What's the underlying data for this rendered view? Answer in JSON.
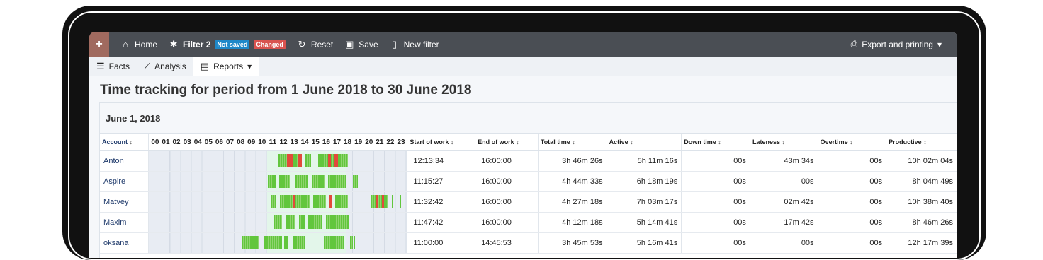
{
  "toolbar": {
    "plus": "+",
    "home": "Home",
    "filter": "Filter 2",
    "badge_not_saved": "Not saved",
    "badge_changed": "Changed",
    "reset": "Reset",
    "save": "Save",
    "new_filter": "New filter",
    "export": "Export and printing"
  },
  "tabs": [
    {
      "label": "Facts",
      "icon": "list-icon"
    },
    {
      "label": "Analysis",
      "icon": "line-chart-icon"
    },
    {
      "label": "Reports",
      "icon": "report-icon"
    }
  ],
  "page_title": "Time tracking for period from 1 June 2018 to 30 June 2018",
  "date_header": "June 1, 2018",
  "columns": {
    "account": "Account",
    "hours": [
      "00",
      "01",
      "02",
      "03",
      "04",
      "05",
      "06",
      "07",
      "08",
      "09",
      "10",
      "11",
      "12",
      "13",
      "14",
      "15",
      "16",
      "17",
      "18",
      "19",
      "20",
      "21",
      "22",
      "23"
    ],
    "start": "Start of work",
    "end": "End of work",
    "total": "Total time",
    "active": "Active",
    "down": "Down time",
    "lateness": "Lateness",
    "overtime": "Overtime",
    "productive": "Productive"
  },
  "rows": [
    {
      "account": "Anton",
      "start": "12:13:34",
      "end": "16:00:00",
      "total": "3h 46m 26s",
      "active": "5h 11m 16s",
      "down": "00s",
      "lateness": "43m 34s",
      "overtime": "00s",
      "productive": "10h 02m 04s"
    },
    {
      "account": "Aspire",
      "start": "11:15:27",
      "end": "16:00:00",
      "total": "4h 44m 33s",
      "active": "6h 18m 19s",
      "down": "00s",
      "lateness": "00s",
      "overtime": "00s",
      "productive": "8h 04m 49s"
    },
    {
      "account": "Matvey",
      "start": "11:32:42",
      "end": "16:00:00",
      "total": "4h 27m 18s",
      "active": "7h 03m 17s",
      "down": "00s",
      "lateness": "02m 42s",
      "overtime": "00s",
      "productive": "10h 38m 40s"
    },
    {
      "account": "Maxim",
      "start": "11:47:42",
      "end": "16:00:00",
      "total": "4h 12m 18s",
      "active": "5h 14m 41s",
      "down": "00s",
      "lateness": "17m 42s",
      "overtime": "00s",
      "productive": "8h 46m 26s"
    },
    {
      "account": "oksana",
      "start": "11:00:00",
      "end": "14:45:53",
      "total": "3h 45m 53s",
      "active": "5h 16m 41s",
      "down": "00s",
      "lateness": "00s",
      "overtime": "00s",
      "productive": "12h 17m 39s"
    }
  ],
  "colors": {
    "toolbar_bg": "#4a4e54",
    "active_green": "#62c63d",
    "idle_red": "#e24a3b",
    "link_blue": "#1f3a6b"
  }
}
